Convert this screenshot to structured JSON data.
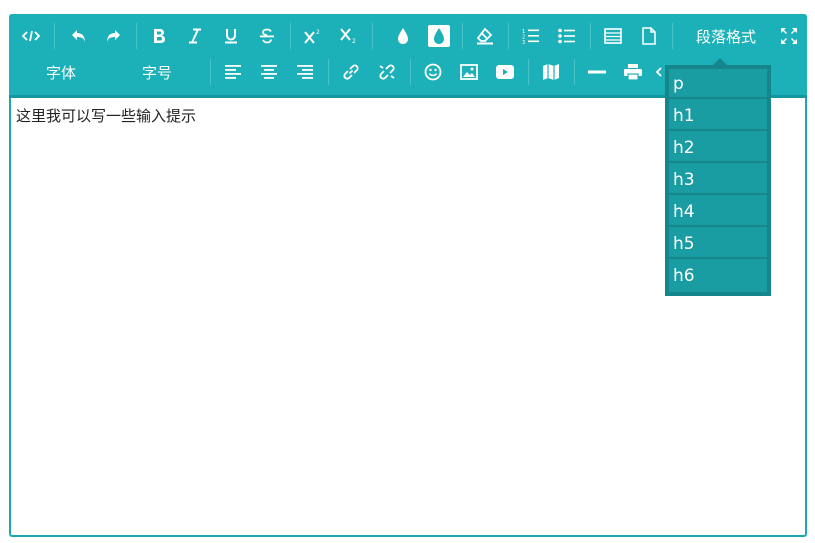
{
  "toolbar": {
    "paragraph_format_label": "段落格式",
    "font_label": "字体",
    "font_size_label": "字号",
    "accent_color": "#1cb0b8",
    "row1_icons": [
      "code-view-icon",
      "undo-icon",
      "redo-icon",
      "bold-icon",
      "italic-icon",
      "underline-icon",
      "strikethrough-icon",
      "superscript-icon",
      "subscript-icon",
      "font-color-icon",
      "background-color-icon",
      "eraser-icon",
      "ordered-list-icon",
      "unordered-list-icon",
      "table-icon",
      "new-document-icon",
      "fullscreen-icon"
    ],
    "row2_icons": [
      "align-left-icon",
      "align-center-icon",
      "align-right-icon",
      "link-icon",
      "unlink-icon",
      "emoji-icon",
      "image-icon",
      "video-icon",
      "map-icon",
      "horizontal-rule-icon",
      "print-icon",
      "code-icon"
    ]
  },
  "editor": {
    "content_text": "这里我可以写一些输入提示"
  },
  "dropdown": {
    "items": [
      "p",
      "h1",
      "h2",
      "h3",
      "h4",
      "h5",
      "h6"
    ]
  }
}
